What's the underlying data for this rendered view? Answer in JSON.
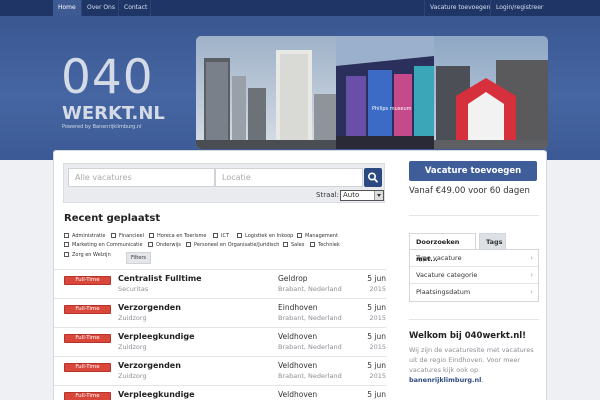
{
  "nav": {
    "left": [
      "Home",
      "Over Ons",
      "Contact"
    ],
    "right": [
      "Vacature toevoegen",
      "Login/registreer"
    ]
  },
  "logo": {
    "number": "040",
    "name": "WERKT.NL",
    "tagline": "Powered by Banenrijklimburg.nl"
  },
  "banner": {
    "sign_text": "Philips museum"
  },
  "search": {
    "what_placeholder": "Alle vacatures",
    "where_placeholder": "Locatie",
    "radius_label": "Straal:",
    "radius_value": "Auto"
  },
  "recent": {
    "title": "Recent geplaatst",
    "categories": [
      "Administratie",
      "Financieel",
      "Horeca en Toerisme",
      "ICT",
      "Logistiek en Inkoop",
      "Management",
      "Marketing en Communicatie",
      "Onderwijs",
      "Personeel en Organisatie/Juridisch",
      "Sales",
      "Techniek",
      "Zorg en Welzijn"
    ],
    "filter_label": "Filters",
    "jobs": [
      {
        "type": "Full-Time",
        "title": "Centralist Fulltime",
        "company": "Securitas",
        "city": "Geldrop",
        "region": "Brabant, Nederland",
        "date": "5 jun",
        "year": "2015"
      },
      {
        "type": "Full-Time",
        "title": "Verzorgenden",
        "company": "Zuidzorg",
        "city": "Eindhoven",
        "region": "Brabant, Nederland",
        "date": "5 jun",
        "year": "2015"
      },
      {
        "type": "Full-Time",
        "title": "Verpleegkundige",
        "company": "Zuidzorg",
        "city": "Veldhoven",
        "region": "Brabant, Nederland",
        "date": "5 jun",
        "year": "2015"
      },
      {
        "type": "Full-Time",
        "title": "Verzorgenden",
        "company": "Zuidzorg",
        "city": "Veldhoven",
        "region": "Brabant, Nederland",
        "date": "5 jun",
        "year": "2015"
      },
      {
        "type": "Full-Time",
        "title": "Verpleegkundige",
        "company": "",
        "city": "Veldhoven",
        "region": "",
        "date": "5 jun",
        "year": ""
      }
    ]
  },
  "sidebar": {
    "add_button": "Vacature toevoegen",
    "price_text": "Vanaf €49.00 voor 60 dagen",
    "tabs": [
      "Doorzoeken met...",
      "Tags"
    ],
    "menu": [
      "Type vacature",
      "Vacature categorie",
      "Plaatsingsdatum"
    ],
    "welcome_title": "Welkom bij 040werkt.nl!",
    "welcome_text": "Wij zijn de vacaturesite met vacatures uit de regio Eindhoven. Voor meer vacatures kijk ook op ",
    "welcome_link": "banenrijklimburg.nl",
    "welcome_end": "."
  },
  "colors": {
    "nav_bg": "#1f3566",
    "header_bg": "#4666a3",
    "accent": "#3e5d99",
    "badge": "#d9463a"
  }
}
